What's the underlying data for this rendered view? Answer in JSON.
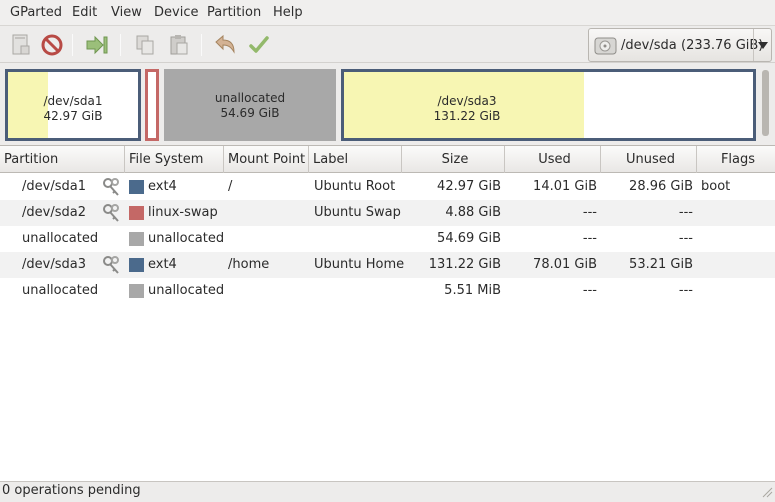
{
  "menubar": {
    "items": [
      {
        "label": "GParted"
      },
      {
        "label": "Edit"
      },
      {
        "label": "View"
      },
      {
        "label": "Device"
      },
      {
        "label": "Partition"
      },
      {
        "label": "Help"
      }
    ]
  },
  "toolbar": {
    "buttons": [
      {
        "icon": "new-partition-icon"
      },
      {
        "icon": "delete-icon"
      },
      {
        "icon": "resize-move-icon"
      },
      {
        "icon": "copy-icon"
      },
      {
        "icon": "paste-icon"
      },
      {
        "icon": "undo-icon"
      },
      {
        "icon": "apply-icon"
      }
    ],
    "device": {
      "name": "/dev/sda",
      "size": "(233.76 GiB)",
      "icon": "hard-disk-icon"
    }
  },
  "diskmap": {
    "segments": [
      {
        "name": "/dev/sda1",
        "size": "42.97 GiB",
        "type": "ext4",
        "used_fraction": 0.326
      },
      {
        "name": "",
        "size": "",
        "type": "linux-swap",
        "used_fraction": 0
      },
      {
        "name": "unallocated",
        "size": "54.69 GiB",
        "type": "unallocated"
      },
      {
        "name": "/dev/sda3",
        "size": "131.22 GiB",
        "type": "ext4",
        "used_fraction": 0.595
      }
    ]
  },
  "table": {
    "columns": [
      "Partition",
      "File System",
      "Mount Point",
      "Label",
      "Size",
      "Used",
      "Unused",
      "Flags"
    ],
    "rows": [
      {
        "partition": "/dev/sda1",
        "locked": true,
        "fs": "ext4",
        "fs_color": "#4b6a8c",
        "mount": "/",
        "label": "Ubuntu Root",
        "size": "42.97 GiB",
        "used": "14.01 GiB",
        "unused": "28.96 GiB",
        "flags": "boot"
      },
      {
        "partition": "/dev/sda2",
        "locked": true,
        "fs": "linux-swap",
        "fs_color": "#c46866",
        "mount": "",
        "label": "Ubuntu Swap",
        "size": "4.88 GiB",
        "used": "---",
        "unused": "---",
        "flags": ""
      },
      {
        "partition": "unallocated",
        "locked": false,
        "fs": "unallocated",
        "fs_color": "#a8a8a8",
        "mount": "",
        "label": "",
        "size": "54.69 GiB",
        "used": "---",
        "unused": "---",
        "flags": ""
      },
      {
        "partition": "/dev/sda3",
        "locked": true,
        "fs": "ext4",
        "fs_color": "#4b6a8c",
        "mount": "/home",
        "label": "Ubuntu Home",
        "size": "131.22 GiB",
        "used": "78.01 GiB",
        "unused": "53.21 GiB",
        "flags": ""
      },
      {
        "partition": "unallocated",
        "locked": false,
        "fs": "unallocated",
        "fs_color": "#a8a8a8",
        "mount": "",
        "label": "",
        "size": "5.51 MiB",
        "used": "---",
        "unused": "---",
        "flags": ""
      }
    ]
  },
  "status": {
    "text": "0 operations pending"
  }
}
